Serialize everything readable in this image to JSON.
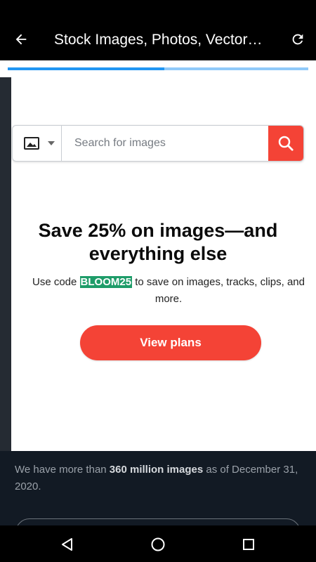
{
  "appbar": {
    "title": "Stock Images, Photos, Vectors, Video, and Music | Shutterstock",
    "back_icon": "arrow-left-icon",
    "reload_icon": "refresh-icon"
  },
  "progress": {
    "value": 0.52
  },
  "search": {
    "type_icon": "image-icon",
    "dropdown_icon": "caret-down-icon",
    "placeholder": "Search for images",
    "value": "",
    "button_icon": "search-icon"
  },
  "promo": {
    "heading": "Save 25% on images—and everything else",
    "text_before": "Use code ",
    "code": "BLOOM25",
    "text_after": " to save on images, tracks, clips, and more.",
    "button_label": "View plans"
  },
  "stats": {
    "text_before": "We have more than ",
    "highlight": "360 million images",
    "text_after": " as of December 31, 2020."
  },
  "colors": {
    "accent": "#f44336",
    "code_bg": "#1e9c69",
    "progress": "#2196f3",
    "progress_track": "#90caf9",
    "dark_bg": "#121a24"
  },
  "navbar": {
    "back_icon": "nav-back-triangle-icon",
    "home_icon": "nav-home-circle-icon",
    "recents_icon": "nav-recents-square-icon"
  }
}
